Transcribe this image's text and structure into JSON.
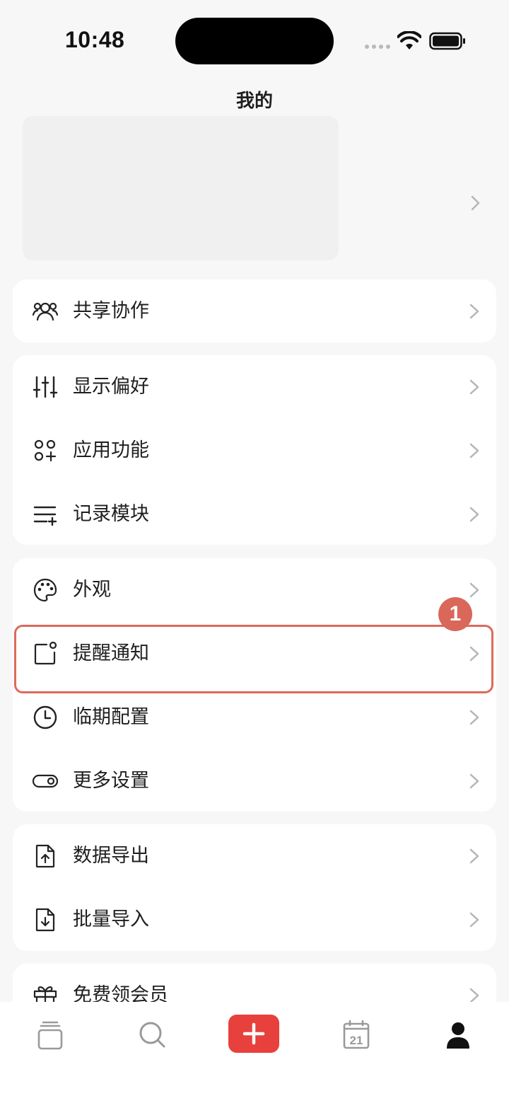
{
  "status_bar": {
    "time": "10:48"
  },
  "header": {
    "title": "我的"
  },
  "groups": [
    {
      "items": [
        {
          "label": "共享协作",
          "icon": "people-icon"
        }
      ]
    },
    {
      "items": [
        {
          "label": "显示偏好",
          "icon": "sliders-icon"
        },
        {
          "label": "应用功能",
          "icon": "apps-icon"
        },
        {
          "label": "记录模块",
          "icon": "list-add-icon"
        }
      ]
    },
    {
      "items": [
        {
          "label": "外观",
          "icon": "palette-icon"
        },
        {
          "label": "提醒通知",
          "icon": "notification-icon"
        },
        {
          "label": "临期配置",
          "icon": "clock-icon"
        },
        {
          "label": "更多设置",
          "icon": "toggle-icon"
        }
      ]
    },
    {
      "items": [
        {
          "label": "数据导出",
          "icon": "file-export-icon"
        },
        {
          "label": "批量导入",
          "icon": "file-import-icon"
        }
      ]
    },
    {
      "items": [
        {
          "label": "免费领会员",
          "icon": "gift-icon"
        }
      ]
    }
  ],
  "highlight": {
    "badge": "1",
    "color": "#dd6a5b"
  },
  "tab_bar": {
    "tabs": [
      {
        "icon": "cards-icon"
      },
      {
        "icon": "search-icon"
      },
      {
        "icon": "add-icon"
      },
      {
        "icon": "calendar-icon",
        "label": "21"
      },
      {
        "icon": "person-icon"
      }
    ],
    "accent": "#e8403c"
  }
}
